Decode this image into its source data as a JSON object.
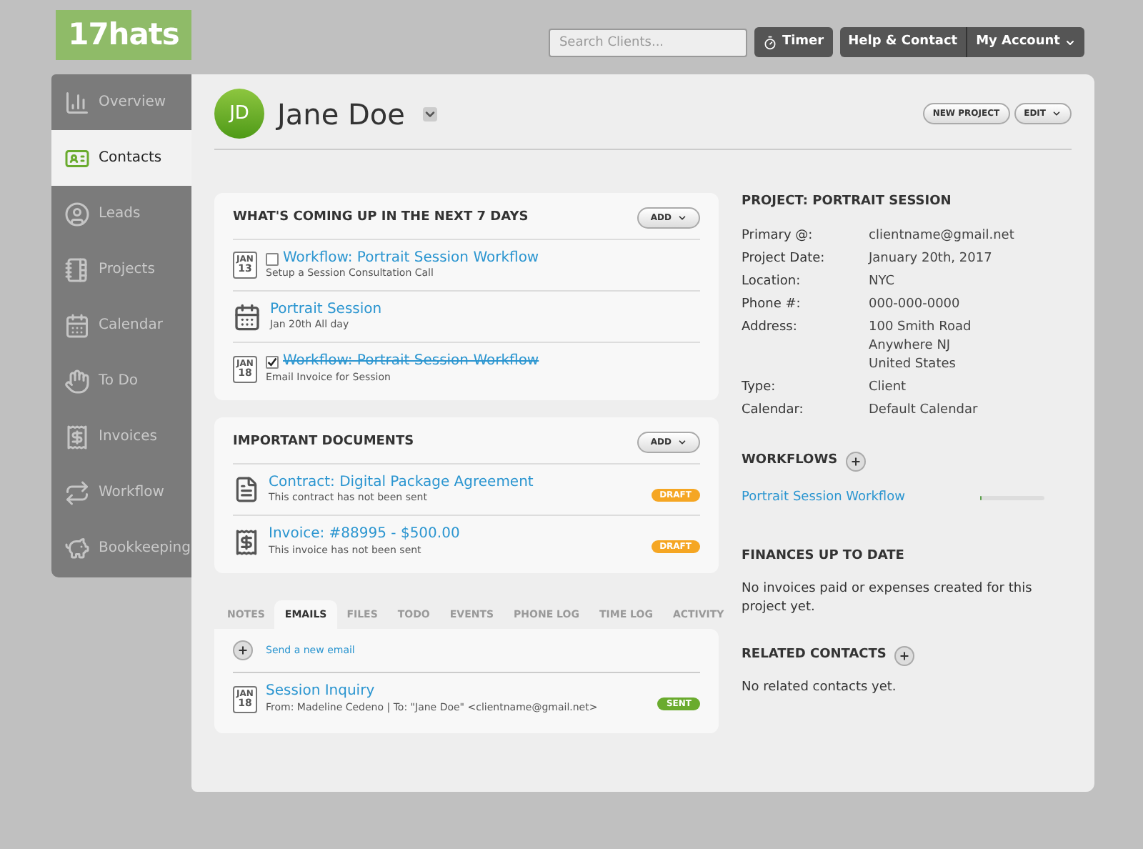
{
  "logo": "17hats",
  "header": {
    "search": {
      "placeholder": "Search Clients..."
    },
    "buttons": [
      "Timer",
      "Help & Contact",
      "My Account"
    ]
  },
  "sidebar": {
    "items": [
      {
        "label": "Overview",
        "selected": false
      },
      {
        "label": "Contacts",
        "selected": true
      },
      {
        "label": "Leads",
        "selected": false
      },
      {
        "label": "Projects",
        "selected": false
      },
      {
        "label": "Calendar",
        "selected": false
      },
      {
        "label": "To Do",
        "selected": false
      },
      {
        "label": "Invoices",
        "selected": false
      },
      {
        "label": "Workflow",
        "selected": false
      },
      {
        "label": "Bookkeeping",
        "selected": false
      }
    ]
  },
  "contact": {
    "initials": "JD",
    "name": "Jane Doe",
    "actions": [
      "NEW PROJECT",
      "EDIT"
    ]
  },
  "upcoming": {
    "title": "WHAT'S COMING UP IN THE NEXT 7 DAYS",
    "add": "ADD",
    "items": [
      {
        "kind": "task",
        "month": "JAN",
        "day": "13",
        "checked": false,
        "title": "Workflow: Portrait Session Workflow",
        "subtitle": "Setup a Session Consultation Call"
      },
      {
        "kind": "event",
        "title": "Portrait Session",
        "subtitle": "Jan 20th All day"
      },
      {
        "kind": "task",
        "month": "JAN",
        "day": "18",
        "checked": true,
        "title": "Workflow: Portrait Session Workflow",
        "subtitle": "Email Invoice for Session"
      }
    ]
  },
  "documents": {
    "title": "IMPORTANT DOCUMENTS",
    "add": "ADD",
    "items": [
      {
        "kind": "contract",
        "title": "Contract: Digital Package Agreement",
        "subtitle": "This contract has not been sent",
        "status": "DRAFT"
      },
      {
        "kind": "invoice",
        "title": "Invoice: #88995 - $500.00",
        "subtitle": "This invoice has not been sent",
        "status": "DRAFT"
      }
    ]
  },
  "tabs": [
    {
      "label": "NOTES",
      "selected": false
    },
    {
      "label": "EMAILS",
      "selected": true
    },
    {
      "label": "FILES",
      "selected": false
    },
    {
      "label": "TODO",
      "selected": false
    },
    {
      "label": "EVENTS",
      "selected": false
    },
    {
      "label": "PHONE LOG",
      "selected": false
    },
    {
      "label": "TIME LOG",
      "selected": false
    },
    {
      "label": "ACTIVITY",
      "selected": false
    }
  ],
  "emails": {
    "new_link": "Send a new email",
    "items": [
      {
        "month": "JAN",
        "day": "18",
        "subject": "Session Inquiry",
        "meta": "From: Madeline Cedeno | To: \"Jane Doe\" <clientname@gmail.net>",
        "status": "SENT"
      }
    ]
  },
  "project": {
    "title": "PROJECT: PORTRAIT SESSION",
    "fields": [
      {
        "label": "Primary @:",
        "lines": [
          "clientname@gmail.net"
        ]
      },
      {
        "label": "Project Date:",
        "lines": [
          "January 20th, 2017"
        ]
      },
      {
        "label": "Location:",
        "lines": [
          "NYC"
        ]
      },
      {
        "label": "Phone #:",
        "lines": [
          "000-000-0000"
        ]
      },
      {
        "label": "Address:",
        "lines": [
          "100 Smith Road",
          "Anywhere NJ",
          "United States"
        ]
      },
      {
        "label": "Type:",
        "lines": [
          "Client"
        ]
      },
      {
        "label": "Calendar:",
        "lines": [
          "Default Calendar"
        ]
      }
    ]
  },
  "workflows": {
    "title": "WORKFLOWS",
    "items": [
      {
        "name": "Portrait Session Workflow",
        "level": 0.03
      }
    ]
  },
  "finances": {
    "title": "FINANCES UP TO DATE",
    "text": "No invoices paid or expenses created for this project yet."
  },
  "related": {
    "title": "RELATED CONTACTS",
    "text": "No related contacts yet."
  }
}
